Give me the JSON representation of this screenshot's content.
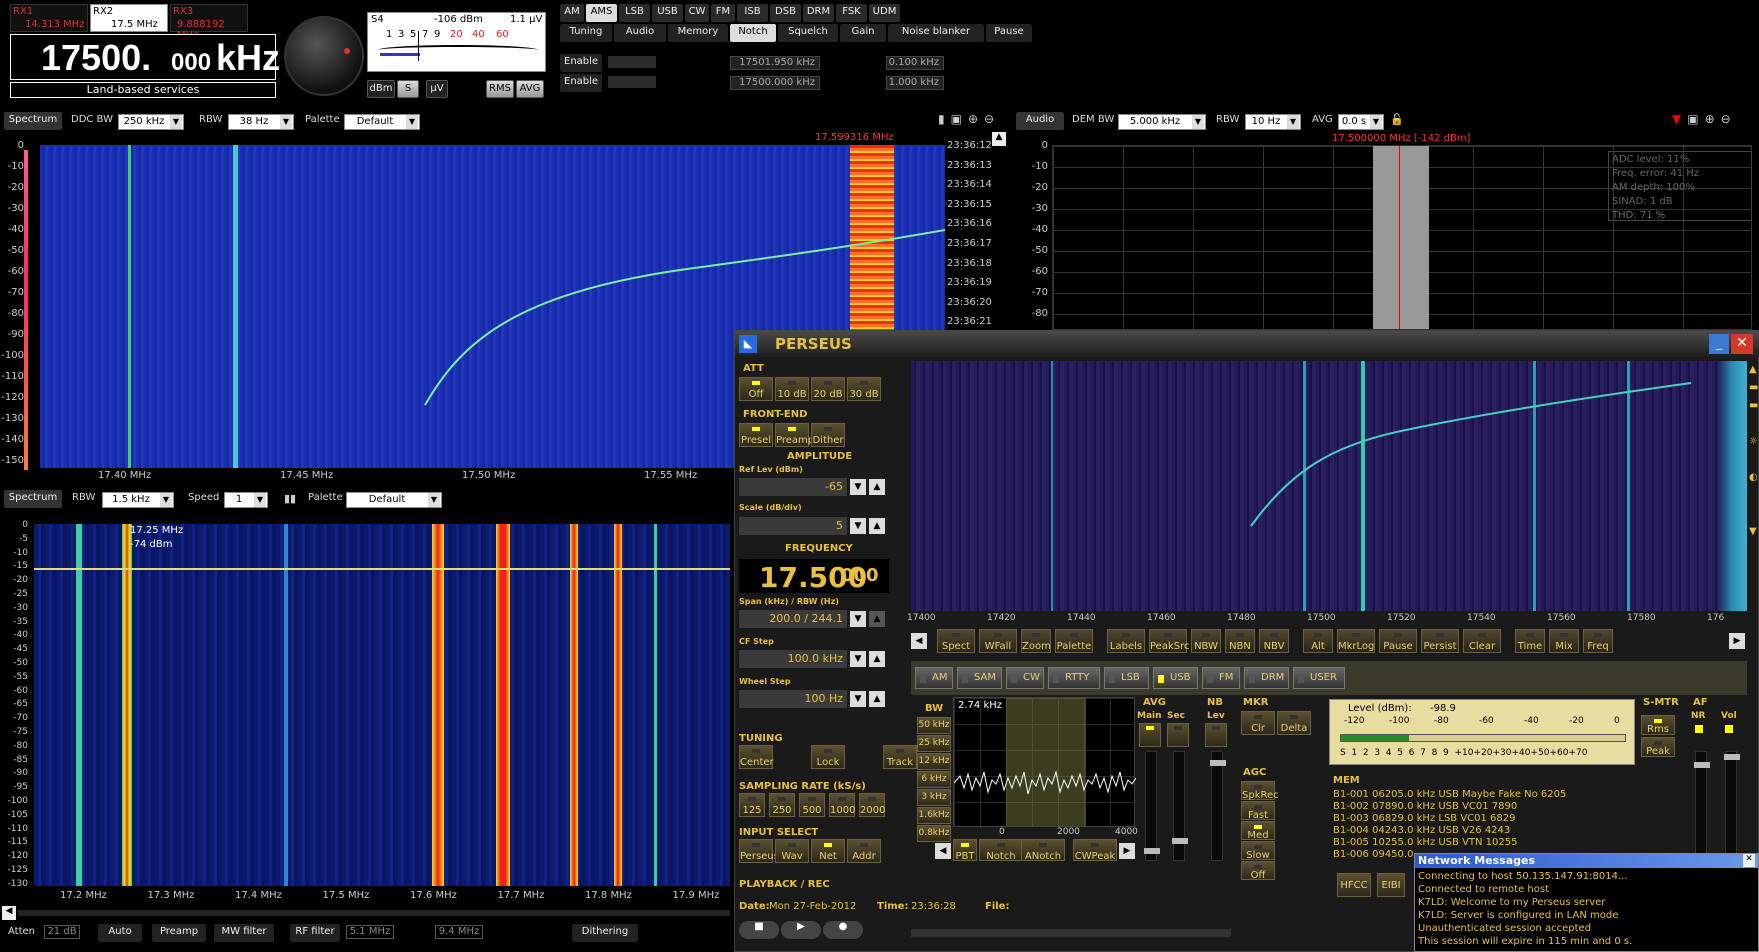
{
  "receivers": {
    "rx1": {
      "label": "RX1",
      "freq": "14.313 MHz"
    },
    "rx2": {
      "label": "RX2",
      "freq": "17.5 MHz"
    },
    "rx3": {
      "label": "RX3",
      "freq": "9.888192 MHz"
    }
  },
  "main_freq": {
    "value": "17500.",
    "fraction": "000",
    "unit": "kHz",
    "band": "Land-based services"
  },
  "smeter": {
    "reading": "S4",
    "dbm": "-106 dBm",
    "uv": "1.1 µV",
    "scale": [
      "1",
      "3",
      "5",
      "7",
      "9",
      "20",
      "40",
      "60"
    ],
    "units": [
      "dBm",
      "S",
      "µV"
    ],
    "modes": [
      "RMS",
      "AVG"
    ]
  },
  "modes": [
    "AM",
    "AMS",
    "LSB",
    "USB",
    "CW",
    "FM",
    "ISB",
    "DSB",
    "DRM",
    "FSK",
    "UDM"
  ],
  "active_mode": "AMS",
  "tabs": [
    "Tuning",
    "Audio",
    "Memory",
    "Notch",
    "Squelch",
    "Gain",
    "Noise blanker",
    "Pause"
  ],
  "active_tab": "Notch",
  "notch": {
    "enable1": "Enable",
    "enable2": "Enable",
    "f1": "17501.950 kHz",
    "f2": "17500.000 kHz",
    "w1": "0.100 kHz",
    "w2": "1.000 kHz"
  },
  "spectrum1": {
    "title": "Spectrum",
    "ddc_label": "DDC BW",
    "ddc": "250 kHz",
    "rbw_label": "RBW",
    "rbw": "38 Hz",
    "palette_label": "Palette",
    "palette": "Default",
    "marker": "17.599316 MHz",
    "yticks": [
      "0",
      "-10",
      "-20",
      "-30",
      "-40",
      "-50",
      "-60",
      "-70",
      "-80",
      "-90",
      "-100",
      "-110",
      "-120",
      "-130",
      "-140",
      "-150"
    ],
    "xticks": [
      "17.40 MHz",
      "17.45 MHz",
      "17.50 MHz",
      "17.55 MHz"
    ],
    "times": [
      "23:36:12",
      "23:36:13",
      "23:36:14",
      "23:36:15",
      "23:36:16",
      "23:36:17",
      "23:36:18",
      "23:36:19",
      "23:36:20",
      "23:36:21"
    ]
  },
  "audio": {
    "title": "Audio",
    "dem_label": "DEM BW",
    "dem": "5.000 kHz",
    "rbw_label": "RBW",
    "rbw": "10 Hz",
    "avg_label": "AVG",
    "avg": "0.0 s",
    "marker": "17.500000 MHz [-142 dBm]",
    "yticks": [
      "0",
      "-10",
      "-20",
      "-30",
      "-40",
      "-50",
      "-60",
      "-70",
      "-80"
    ],
    "info": [
      "ADC level: 11%",
      "Freq. error: 41 Hz",
      "AM depth: 100%",
      "SINAD: 1 dB",
      "THD: 71 %"
    ]
  },
  "spectrum2": {
    "title": "Spectrum",
    "rbw_label": "RBW",
    "rbw": "1.5 kHz",
    "speed_label": "Speed",
    "speed": "1",
    "palette_label": "Palette",
    "palette": "Default",
    "cursor_freq": "17.25 MHz",
    "cursor_level": "-74 dBm",
    "yticks": [
      "0",
      "-5",
      "-10",
      "-15",
      "-20",
      "-25",
      "-30",
      "-35",
      "-40",
      "-45",
      "-50",
      "-55",
      "-60",
      "-65",
      "-70",
      "-75",
      "-80",
      "-85",
      "-90",
      "-95",
      "-100",
      "-105",
      "-110",
      "-115",
      "-120",
      "-125",
      "-130"
    ],
    "xticks": [
      "17.2 MHz",
      "17.3 MHz",
      "17.4 MHz",
      "17.5 MHz",
      "17.6 MHz",
      "17.7 MHz",
      "17.8 MHz",
      "17.9 MHz"
    ]
  },
  "bottom_bar": {
    "atten_label": "Atten",
    "atten": "21 dB",
    "auto": "Auto",
    "preamp": "Preamp",
    "mw": "MW filter",
    "rf": "RF filter",
    "rf_val": "5.1 MHz",
    "rf_val2": "9.4 MHz",
    "dither": "Dithering"
  },
  "perseus": {
    "title": "PERSEUS",
    "att_title": "ATT",
    "att": [
      "Off",
      "10 dB",
      "20 dB",
      "30 dB"
    ],
    "fe_title": "FRONT-END",
    "fe": [
      "Presel",
      "Preamp",
      "Dither"
    ],
    "amp_title": "AMPLITUDE",
    "ref_label": "Ref Lev (dBm)",
    "ref": "-65",
    "scale_label": "Scale (dB/div)",
    "scale": "5",
    "freq_title": "FREQUENCY",
    "freq": "17.500",
    "freq_frac": "000",
    "span_label": "Span (kHz) / RBW (Hz)",
    "span": "200.0 / 244.1",
    "cf_label": "CF Step",
    "cf": "100.0 kHz",
    "wheel_label": "Wheel Step",
    "wheel": "100 Hz",
    "tuning_title": "TUNING",
    "tuning": [
      "Center",
      "Lock",
      "Track"
    ],
    "sr_title": "SAMPLING RATE (kS/s)",
    "sr": [
      "125",
      "250",
      "500",
      "1000",
      "2000"
    ],
    "input_title": "INPUT SELECT",
    "input": [
      "Perseus",
      "Wav",
      "Net",
      "Addr"
    ],
    "pb_title": "PLAYBACK / REC",
    "date_label": "Date:",
    "date": "Mon 27-Feb-2012",
    "time_label": "Time:",
    "time": "23:36:28",
    "file_label": "File:",
    "xticks": [
      "17400",
      "17420",
      "17440",
      "17460",
      "17480",
      "17500",
      "17520",
      "17540",
      "17560",
      "17580",
      "176"
    ],
    "spect_btns": [
      "Spect",
      "WFall",
      "Zoom",
      "Palette",
      "Labels",
      "PeakSrc",
      "NBW",
      "NBN",
      "NBV",
      "Alt",
      "MkrLog",
      "Pause",
      "Persist",
      "Clear",
      "Time",
      "Mix",
      "Freq"
    ],
    "modes": [
      "AM",
      "SAM",
      "CW",
      "RTTY",
      "LSB",
      "USB",
      "FM",
      "DRM",
      "USER"
    ],
    "active_mode": "USB",
    "bw_title": "BW",
    "bw_val": "2.74 kHz",
    "bw_btns": [
      "50 kHz",
      "25 kHz",
      "12 kHz",
      "6 kHz",
      "3 kHz",
      "1.6kHz",
      "0.8kHz"
    ],
    "bw_ticks": [
      "0",
      "2000",
      "4000"
    ],
    "filt_btns": [
      "PBT",
      "Notch",
      "ANotch",
      "CWPeak"
    ],
    "avg_title": "AVG",
    "avg_main": "Main",
    "avg_sec": "Sec",
    "nb_title": "NB",
    "nb_lev": "Lev",
    "mkr_title": "MKR",
    "mkr": [
      "Clr",
      "Delta"
    ],
    "agc_title": "AGC",
    "agc": [
      "SpkRec",
      "Fast",
      "Med",
      "Slow",
      "Off"
    ],
    "level_label": "Level (dBm):",
    "level": "-98.9",
    "level_scale": [
      "-120",
      "-100",
      "-80",
      "-60",
      "-40",
      "-20",
      "0"
    ],
    "s_scale": "S  1  2  3  4  5  6  7  8  9  +10+20+30+40+50+60+70",
    "smtr_title": "S-MTR",
    "smtr": [
      "Rms",
      "Peak"
    ],
    "af_title": "AF",
    "af": [
      "NR",
      "Vol"
    ],
    "mem_title": "MEM",
    "mem": [
      "B1-001 06205.0 kHz USB  Maybe Fake No 6205",
      "B1-002 07890.0 kHz USB  VC01 7890",
      "B1-003 06829.0 kHz LSB  VC01 6829",
      "B1-004 04243.0 kHz USB  V26 4243",
      "B1-005 10255.0 kHz USB  VTN 10255",
      "B1-006 09450.0"
    ],
    "hfcc": "HFCC",
    "eibi": "EIBI"
  },
  "netmsg": {
    "title": "Network Messages",
    "lines": [
      "Connecting to host 50.135.147.91:8014...",
      "Connected to remote host",
      "K7LD: Welcome to my Perseus server",
      "K7LD: Server is configured in LAN mode",
      "Unauthenticated session accepted",
      "This session will expire in 115 min and 0 s."
    ]
  }
}
